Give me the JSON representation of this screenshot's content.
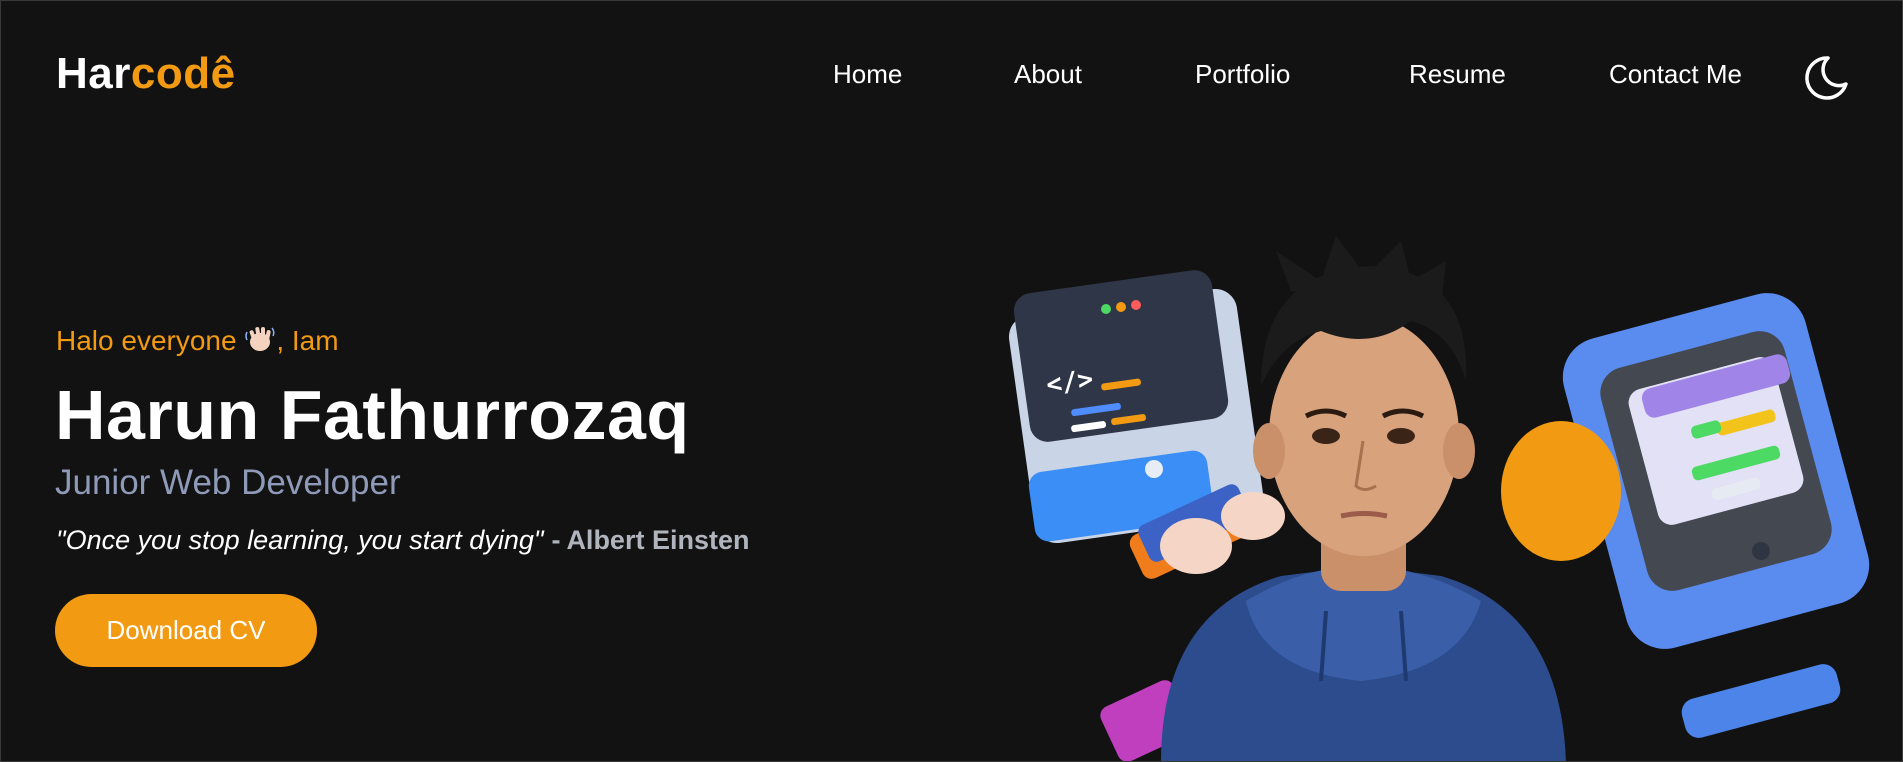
{
  "header": {
    "logo_prefix": "Har",
    "logo_accent": "codê",
    "nav": {
      "home": "Home",
      "about": "About",
      "portfolio": "Portfolio",
      "resume": "Resume",
      "contact": "Contact Me"
    },
    "theme_icon": "moon-icon"
  },
  "hero": {
    "greeting_before": "Halo everyone",
    "greeting_icon": "waving-hand-icon",
    "greeting_after": ", Iam",
    "name": "Harun Fathurrozaq",
    "role": "Junior Web Developer",
    "quote": "\"Once you stop learning, you start dying\"",
    "quote_separator": "-",
    "quote_author": "Albert Einsten",
    "cta_label": "Download CV"
  },
  "colors": {
    "background": "#121212",
    "accent": "#f29b12",
    "text": "#ffffff",
    "role_text": "#8e9ab8",
    "author_text": "#b0b4bc"
  }
}
